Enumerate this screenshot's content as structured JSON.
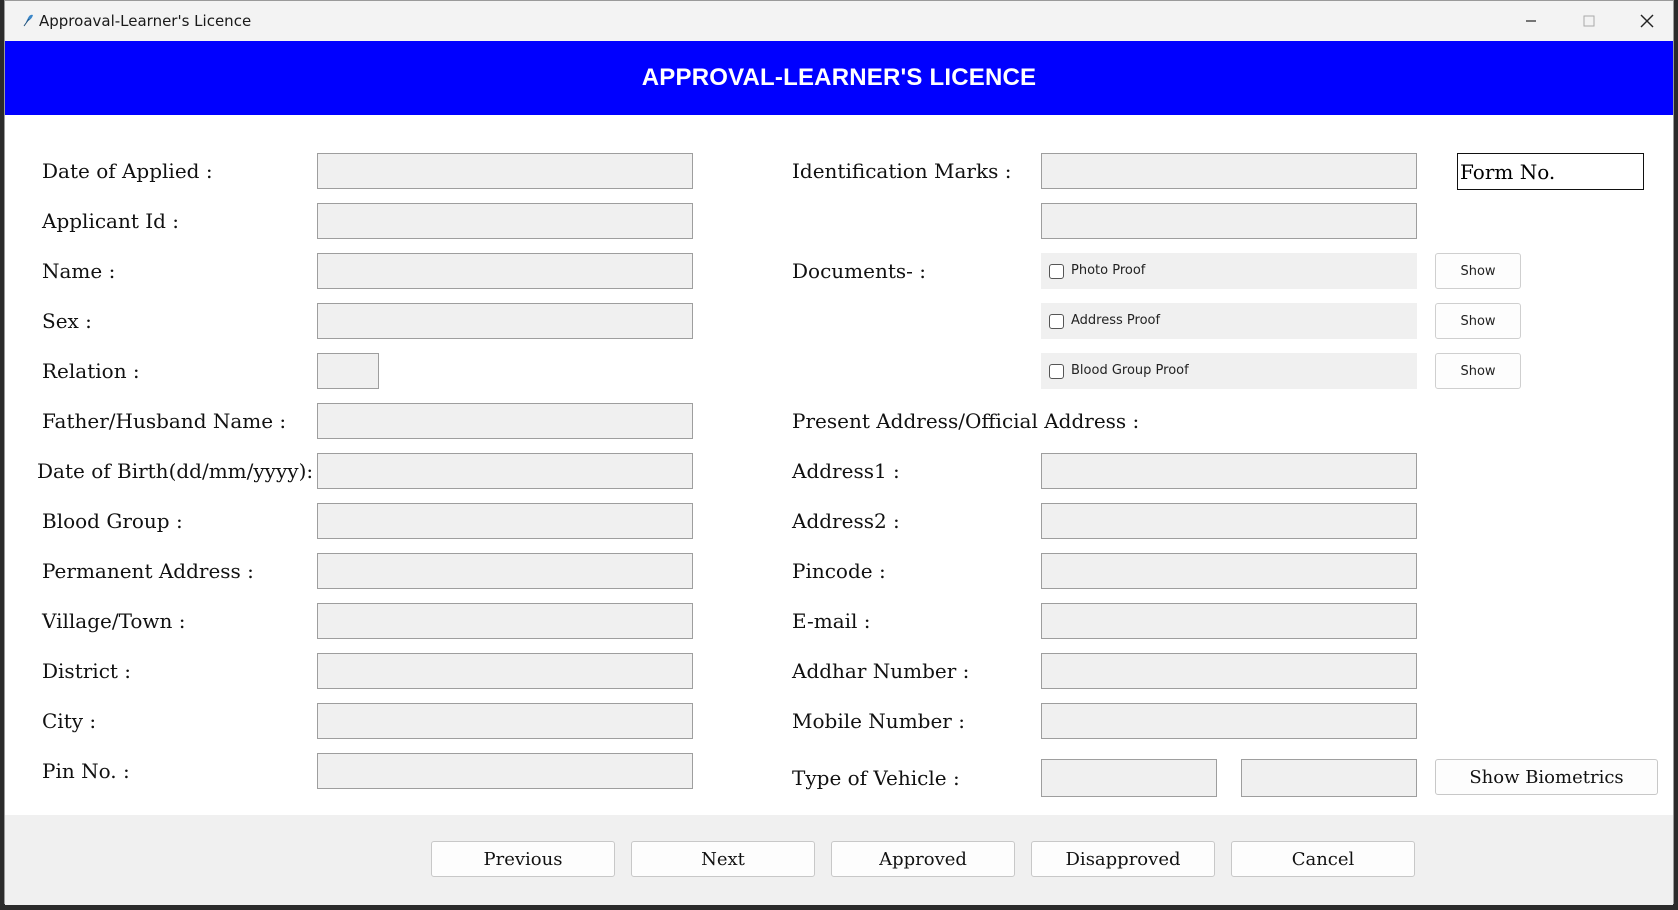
{
  "window": {
    "title": "Approaval-Learner's Licence"
  },
  "header": {
    "title": "APPROVAL-LEARNER'S LICENCE"
  },
  "left_labels": [
    "Date of Applied :",
    "Applicant Id :",
    "Name :",
    "Sex :",
    "Relation :",
    "Father/Husband Name :",
    "Date of Birth(dd/mm/yyyy):",
    "Blood Group :",
    "Permanent Address :",
    "Village/Town :",
    "District :",
    "City :",
    "Pin No. :"
  ],
  "right": {
    "identification_marks": "Identification Marks :",
    "form_no": "Form No.",
    "documents": "Documents- :",
    "docs": [
      {
        "label": "Photo Proof",
        "button": "Show"
      },
      {
        "label": "Address Proof",
        "button": "Show"
      },
      {
        "label": "Blood Group Proof",
        "button": "Show"
      }
    ],
    "present_address": "Present Address/Official Address :",
    "address1": "Address1 :",
    "address2": "Address2 :",
    "pincode": "Pincode :",
    "email": "E-mail :",
    "addhar": "Addhar Number :",
    "mobile": "Mobile Number :",
    "vehicle": "Type of Vehicle :",
    "biometrics_button": "Show Biometrics"
  },
  "buttons": {
    "previous": "Previous",
    "next": "Next",
    "approved": "Approved",
    "disapproved": "Disapproved",
    "cancel": "Cancel"
  },
  "colors": {
    "header_bg": "#0000ff",
    "field_bg": "#f0f0f0"
  },
  "icons": {
    "app": "feather-icon",
    "minimize": "minimize-icon",
    "maximize": "maximize-icon",
    "close": "close-icon"
  }
}
